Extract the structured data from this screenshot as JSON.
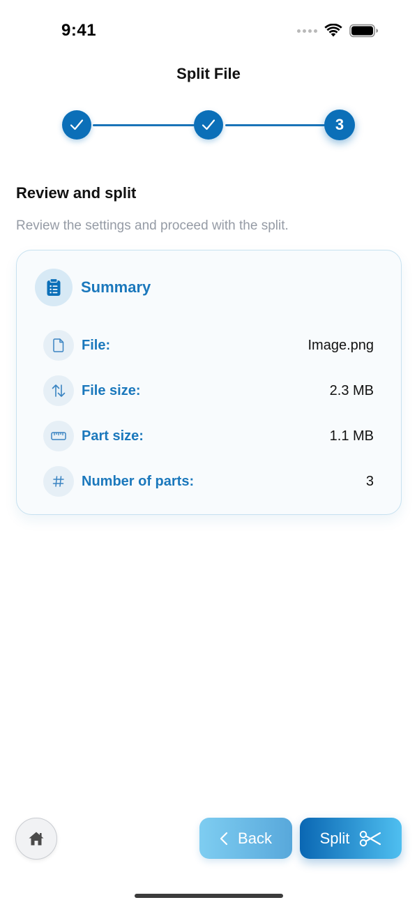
{
  "status_bar": {
    "time": "9:41"
  },
  "header": {
    "title": "Split File"
  },
  "stepper": {
    "steps": [
      {
        "state": "completed",
        "icon": "check-icon"
      },
      {
        "state": "completed",
        "icon": "check-icon"
      },
      {
        "state": "active",
        "label": "3"
      }
    ]
  },
  "section": {
    "title": "Review and split",
    "description": "Review the settings and proceed with the split."
  },
  "summary": {
    "title": "Summary",
    "icon": "clipboard-icon",
    "rows": [
      {
        "icon": "file-icon",
        "label": "File:",
        "value": "Image.png"
      },
      {
        "icon": "swap-vertical-icon",
        "label": "File size:",
        "value": "2.3 MB"
      },
      {
        "icon": "ruler-icon",
        "label": "Part size:",
        "value": "1.1 MB"
      },
      {
        "icon": "hash-icon",
        "label": "Number of parts:",
        "value": "3"
      }
    ]
  },
  "bottom_bar": {
    "home_icon": "home-icon",
    "back_label": "Back",
    "split_label": "Split",
    "split_icon": "scissors-icon"
  },
  "colors": {
    "primary": "#0b6fb8",
    "accent_text": "#1b78bc",
    "muted_text": "#959ba5",
    "card_border": "#c7e1f0"
  }
}
